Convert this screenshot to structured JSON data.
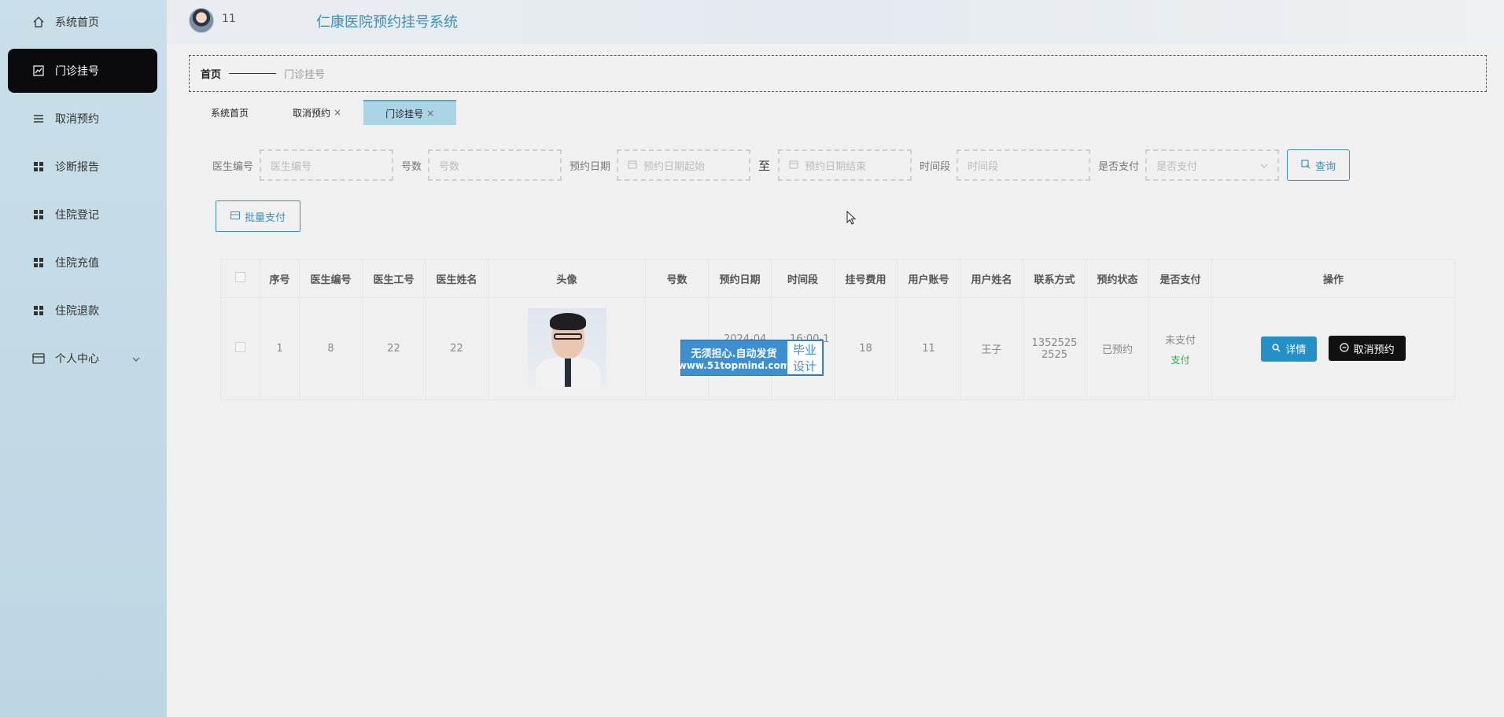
{
  "sidebar": {
    "items": [
      {
        "label": "系统首页",
        "icon": "home-icon"
      },
      {
        "label": "门诊挂号",
        "icon": "chart-icon",
        "active": true
      },
      {
        "label": "取消预约",
        "icon": "list-icon"
      },
      {
        "label": "诊断报告",
        "icon": "grid-icon"
      },
      {
        "label": "住院登记",
        "icon": "grid-icon"
      },
      {
        "label": "住院充值",
        "icon": "grid-icon"
      },
      {
        "label": "住院退款",
        "icon": "grid-icon"
      },
      {
        "label": "个人中心",
        "icon": "card-icon",
        "expandable": true
      }
    ]
  },
  "header": {
    "username": "11",
    "title": "仁康医院预约挂号系统"
  },
  "breadcrumb": {
    "home": "首页",
    "current": "门诊挂号"
  },
  "tabs": [
    {
      "label": "系统首页",
      "closable": false
    },
    {
      "label": "取消预约",
      "closable": true
    },
    {
      "label": "门诊挂号",
      "closable": true,
      "active": true
    }
  ],
  "search": {
    "doctor_no_label": "医生编号",
    "doctor_no_placeholder": "医生编号",
    "count_label": "号数",
    "count_placeholder": "号数",
    "date_label": "预约日期",
    "date_start_placeholder": "预约日期起始",
    "to_label": "至",
    "date_end_placeholder": "预约日期结束",
    "time_label": "时间段",
    "time_placeholder": "时间段",
    "paid_label": "是否支付",
    "paid_placeholder": "是否支付",
    "query_label": "查询"
  },
  "batch_pay_label": "批量支付",
  "table": {
    "columns": [
      "序号",
      "医生编号",
      "医生工号",
      "医生姓名",
      "头像",
      "号数",
      "预约日期",
      "时间段",
      "挂号费用",
      "用户账号",
      "用户姓名",
      "联系方式",
      "预约状态",
      "是否支付",
      "操作"
    ],
    "rows": [
      {
        "index": "1",
        "doctor_no": "8",
        "doctor_id": "22",
        "doctor_name": "22",
        "count": "",
        "date": "2024-04",
        "time": "16:00-1",
        "fee": "18",
        "account": "11",
        "user_name": "王子",
        "phone_line1": "1352525",
        "phone_line2": "2525",
        "status": "已预约",
        "paid": "未支付",
        "pay_action": "支付",
        "detail_label": "详情",
        "cancel_label": "取消预约"
      }
    ]
  },
  "watermark": {
    "line1": "无须担心.自动发货",
    "line2": "www.51topmind.com",
    "badge1": "毕业",
    "badge2": "设计"
  },
  "colors": {
    "accent": "#3d8fb8",
    "sidebar_active": "#0b0b0d",
    "detail_btn": "#2490c8",
    "pay_link": "#2eaa4a"
  }
}
